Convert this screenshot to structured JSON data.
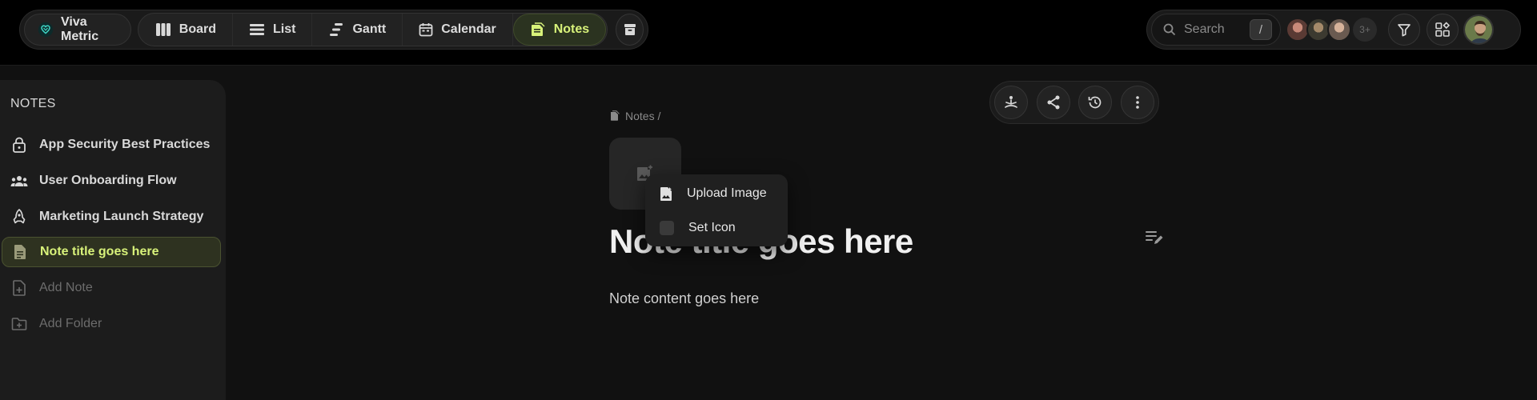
{
  "brand": {
    "name": "Viva Metric"
  },
  "nav": {
    "tabs": [
      {
        "label": "Board",
        "icon": "board-columns-icon"
      },
      {
        "label": "List",
        "icon": "list-icon"
      },
      {
        "label": "Gantt",
        "icon": "gantt-icon"
      },
      {
        "label": "Calendar",
        "icon": "calendar-icon"
      },
      {
        "label": "Notes",
        "icon": "notes-icon",
        "active": true
      }
    ],
    "archive_icon": "archive-icon"
  },
  "header_right": {
    "search": {
      "placeholder": "Search",
      "shortcut": "/"
    },
    "avatars_more": "3+",
    "filter_icon": "filter-icon",
    "apps_icon": "apps-icon"
  },
  "sidebar": {
    "title": "NOTES",
    "items": [
      {
        "label": "App Security Best Practices",
        "icon": "lock-icon"
      },
      {
        "label": "User Onboarding Flow",
        "icon": "group-icon"
      },
      {
        "label": "Marketing Launch Strategy",
        "icon": "rocket-icon"
      },
      {
        "label": "Note title goes here",
        "icon": "document-icon",
        "active": true
      }
    ],
    "add_note": "Add Note",
    "add_folder": "Add Folder"
  },
  "note": {
    "breadcrumb": "Notes /",
    "title": "Note title goes here",
    "content": "Note content goes here"
  },
  "icon_menu": {
    "upload_image": "Upload Image",
    "set_icon": "Set Icon"
  },
  "colors": {
    "accent": "#d8f27a",
    "background": "#111111",
    "topbar": "#000000"
  }
}
